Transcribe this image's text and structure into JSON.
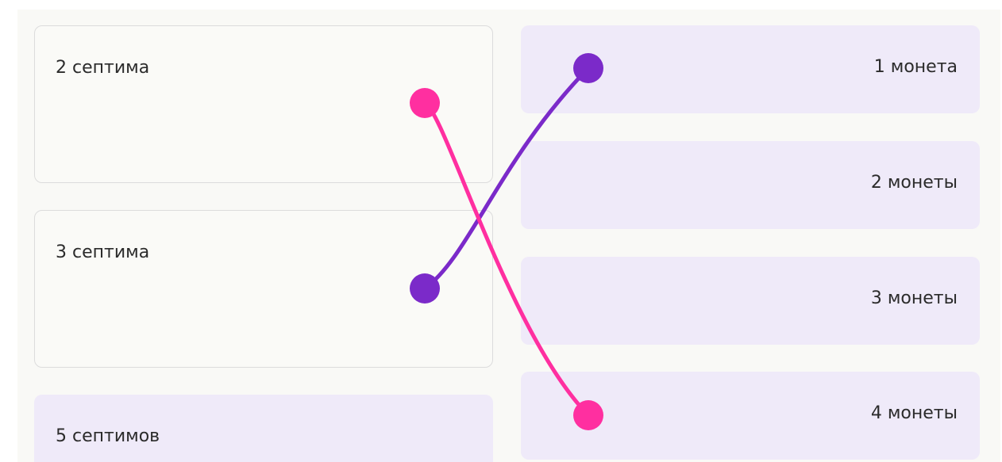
{
  "left_items": [
    {
      "label": "2 септима"
    },
    {
      "label": "3 септима"
    },
    {
      "label": "5 септимов"
    }
  ],
  "right_items": [
    {
      "label": "1 монета"
    },
    {
      "label": "2 монеты"
    },
    {
      "label": "3 монеты"
    },
    {
      "label": "4 монеты"
    }
  ],
  "connections": [
    {
      "from_left": "2 септима",
      "to_right": "4 монеты",
      "color": "#ff2fa0"
    },
    {
      "from_left": "3 септима",
      "to_right": "1 монета",
      "color": "#7b2ac9"
    }
  ],
  "colors": {
    "panel_background": "#f9f9f6",
    "left_card_background": "#fafaf7",
    "left_card_border": "#dcdcdc",
    "right_card_background": "#efeaf9",
    "pink_link": "#ff2fa0",
    "purple_link": "#7b2ac9"
  }
}
